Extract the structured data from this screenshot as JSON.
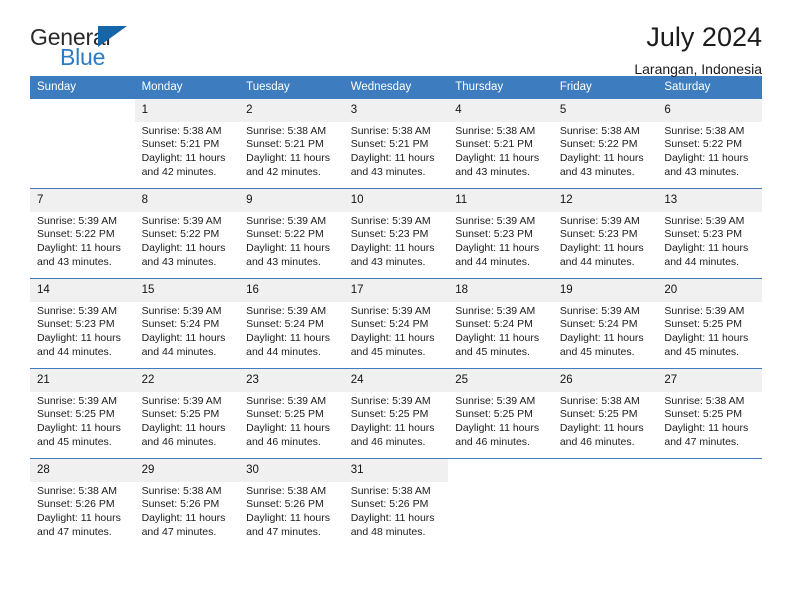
{
  "brand": {
    "name_part1": "General",
    "name_part2": "Blue",
    "logo_icon": "triangle-logo-icon",
    "accent_color": "#1565a8"
  },
  "header": {
    "title": "July 2024",
    "subtitle": "Larangan, Indonesia"
  },
  "theme": {
    "header_row_color": "#3d7cbf",
    "band_color": "#f0f0f0",
    "text_color": "#1c1c1c"
  },
  "calendar": {
    "weekday_headers": [
      "Sunday",
      "Monday",
      "Tuesday",
      "Wednesday",
      "Thursday",
      "Friday",
      "Saturday"
    ],
    "labels": {
      "sunrise": "Sunrise:",
      "sunset": "Sunset:",
      "daylight": "Daylight:"
    },
    "weeks": [
      [
        {
          "day": "",
          "sunrise": "",
          "sunset": "",
          "daylight_line1": "",
          "daylight_line2": "",
          "empty": true
        },
        {
          "day": "1",
          "sunrise": "Sunrise: 5:38 AM",
          "sunset": "Sunset: 5:21 PM",
          "daylight_line1": "Daylight: 11 hours",
          "daylight_line2": "and 42 minutes.",
          "empty": false
        },
        {
          "day": "2",
          "sunrise": "Sunrise: 5:38 AM",
          "sunset": "Sunset: 5:21 PM",
          "daylight_line1": "Daylight: 11 hours",
          "daylight_line2": "and 42 minutes.",
          "empty": false
        },
        {
          "day": "3",
          "sunrise": "Sunrise: 5:38 AM",
          "sunset": "Sunset: 5:21 PM",
          "daylight_line1": "Daylight: 11 hours",
          "daylight_line2": "and 43 minutes.",
          "empty": false
        },
        {
          "day": "4",
          "sunrise": "Sunrise: 5:38 AM",
          "sunset": "Sunset: 5:21 PM",
          "daylight_line1": "Daylight: 11 hours",
          "daylight_line2": "and 43 minutes.",
          "empty": false
        },
        {
          "day": "5",
          "sunrise": "Sunrise: 5:38 AM",
          "sunset": "Sunset: 5:22 PM",
          "daylight_line1": "Daylight: 11 hours",
          "daylight_line2": "and 43 minutes.",
          "empty": false
        },
        {
          "day": "6",
          "sunrise": "Sunrise: 5:38 AM",
          "sunset": "Sunset: 5:22 PM",
          "daylight_line1": "Daylight: 11 hours",
          "daylight_line2": "and 43 minutes.",
          "empty": false
        }
      ],
      [
        {
          "day": "7",
          "sunrise": "Sunrise: 5:39 AM",
          "sunset": "Sunset: 5:22 PM",
          "daylight_line1": "Daylight: 11 hours",
          "daylight_line2": "and 43 minutes.",
          "empty": false
        },
        {
          "day": "8",
          "sunrise": "Sunrise: 5:39 AM",
          "sunset": "Sunset: 5:22 PM",
          "daylight_line1": "Daylight: 11 hours",
          "daylight_line2": "and 43 minutes.",
          "empty": false
        },
        {
          "day": "9",
          "sunrise": "Sunrise: 5:39 AM",
          "sunset": "Sunset: 5:22 PM",
          "daylight_line1": "Daylight: 11 hours",
          "daylight_line2": "and 43 minutes.",
          "empty": false
        },
        {
          "day": "10",
          "sunrise": "Sunrise: 5:39 AM",
          "sunset": "Sunset: 5:23 PM",
          "daylight_line1": "Daylight: 11 hours",
          "daylight_line2": "and 43 minutes.",
          "empty": false
        },
        {
          "day": "11",
          "sunrise": "Sunrise: 5:39 AM",
          "sunset": "Sunset: 5:23 PM",
          "daylight_line1": "Daylight: 11 hours",
          "daylight_line2": "and 44 minutes.",
          "empty": false
        },
        {
          "day": "12",
          "sunrise": "Sunrise: 5:39 AM",
          "sunset": "Sunset: 5:23 PM",
          "daylight_line1": "Daylight: 11 hours",
          "daylight_line2": "and 44 minutes.",
          "empty": false
        },
        {
          "day": "13",
          "sunrise": "Sunrise: 5:39 AM",
          "sunset": "Sunset: 5:23 PM",
          "daylight_line1": "Daylight: 11 hours",
          "daylight_line2": "and 44 minutes.",
          "empty": false
        }
      ],
      [
        {
          "day": "14",
          "sunrise": "Sunrise: 5:39 AM",
          "sunset": "Sunset: 5:23 PM",
          "daylight_line1": "Daylight: 11 hours",
          "daylight_line2": "and 44 minutes.",
          "empty": false
        },
        {
          "day": "15",
          "sunrise": "Sunrise: 5:39 AM",
          "sunset": "Sunset: 5:24 PM",
          "daylight_line1": "Daylight: 11 hours",
          "daylight_line2": "and 44 minutes.",
          "empty": false
        },
        {
          "day": "16",
          "sunrise": "Sunrise: 5:39 AM",
          "sunset": "Sunset: 5:24 PM",
          "daylight_line1": "Daylight: 11 hours",
          "daylight_line2": "and 44 minutes.",
          "empty": false
        },
        {
          "day": "17",
          "sunrise": "Sunrise: 5:39 AM",
          "sunset": "Sunset: 5:24 PM",
          "daylight_line1": "Daylight: 11 hours",
          "daylight_line2": "and 45 minutes.",
          "empty": false
        },
        {
          "day": "18",
          "sunrise": "Sunrise: 5:39 AM",
          "sunset": "Sunset: 5:24 PM",
          "daylight_line1": "Daylight: 11 hours",
          "daylight_line2": "and 45 minutes.",
          "empty": false
        },
        {
          "day": "19",
          "sunrise": "Sunrise: 5:39 AM",
          "sunset": "Sunset: 5:24 PM",
          "daylight_line1": "Daylight: 11 hours",
          "daylight_line2": "and 45 minutes.",
          "empty": false
        },
        {
          "day": "20",
          "sunrise": "Sunrise: 5:39 AM",
          "sunset": "Sunset: 5:25 PM",
          "daylight_line1": "Daylight: 11 hours",
          "daylight_line2": "and 45 minutes.",
          "empty": false
        }
      ],
      [
        {
          "day": "21",
          "sunrise": "Sunrise: 5:39 AM",
          "sunset": "Sunset: 5:25 PM",
          "daylight_line1": "Daylight: 11 hours",
          "daylight_line2": "and 45 minutes.",
          "empty": false
        },
        {
          "day": "22",
          "sunrise": "Sunrise: 5:39 AM",
          "sunset": "Sunset: 5:25 PM",
          "daylight_line1": "Daylight: 11 hours",
          "daylight_line2": "and 46 minutes.",
          "empty": false
        },
        {
          "day": "23",
          "sunrise": "Sunrise: 5:39 AM",
          "sunset": "Sunset: 5:25 PM",
          "daylight_line1": "Daylight: 11 hours",
          "daylight_line2": "and 46 minutes.",
          "empty": false
        },
        {
          "day": "24",
          "sunrise": "Sunrise: 5:39 AM",
          "sunset": "Sunset: 5:25 PM",
          "daylight_line1": "Daylight: 11 hours",
          "daylight_line2": "and 46 minutes.",
          "empty": false
        },
        {
          "day": "25",
          "sunrise": "Sunrise: 5:39 AM",
          "sunset": "Sunset: 5:25 PM",
          "daylight_line1": "Daylight: 11 hours",
          "daylight_line2": "and 46 minutes.",
          "empty": false
        },
        {
          "day": "26",
          "sunrise": "Sunrise: 5:38 AM",
          "sunset": "Sunset: 5:25 PM",
          "daylight_line1": "Daylight: 11 hours",
          "daylight_line2": "and 46 minutes.",
          "empty": false
        },
        {
          "day": "27",
          "sunrise": "Sunrise: 5:38 AM",
          "sunset": "Sunset: 5:25 PM",
          "daylight_line1": "Daylight: 11 hours",
          "daylight_line2": "and 47 minutes.",
          "empty": false
        }
      ],
      [
        {
          "day": "28",
          "sunrise": "Sunrise: 5:38 AM",
          "sunset": "Sunset: 5:26 PM",
          "daylight_line1": "Daylight: 11 hours",
          "daylight_line2": "and 47 minutes.",
          "empty": false
        },
        {
          "day": "29",
          "sunrise": "Sunrise: 5:38 AM",
          "sunset": "Sunset: 5:26 PM",
          "daylight_line1": "Daylight: 11 hours",
          "daylight_line2": "and 47 minutes.",
          "empty": false
        },
        {
          "day": "30",
          "sunrise": "Sunrise: 5:38 AM",
          "sunset": "Sunset: 5:26 PM",
          "daylight_line1": "Daylight: 11 hours",
          "daylight_line2": "and 47 minutes.",
          "empty": false
        },
        {
          "day": "31",
          "sunrise": "Sunrise: 5:38 AM",
          "sunset": "Sunset: 5:26 PM",
          "daylight_line1": "Daylight: 11 hours",
          "daylight_line2": "and 48 minutes.",
          "empty": false
        },
        {
          "day": "",
          "sunrise": "",
          "sunset": "",
          "daylight_line1": "",
          "daylight_line2": "",
          "empty": true
        },
        {
          "day": "",
          "sunrise": "",
          "sunset": "",
          "daylight_line1": "",
          "daylight_line2": "",
          "empty": true
        },
        {
          "day": "",
          "sunrise": "",
          "sunset": "",
          "daylight_line1": "",
          "daylight_line2": "",
          "empty": true
        }
      ]
    ]
  }
}
